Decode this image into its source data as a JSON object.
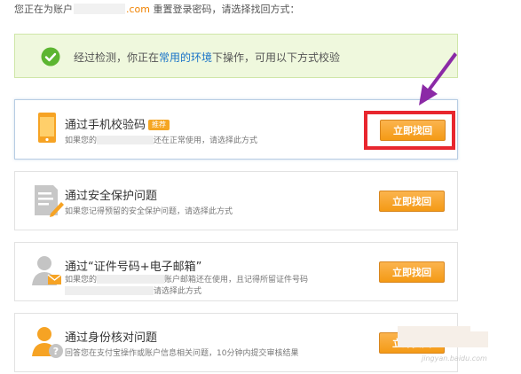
{
  "intro": {
    "prefix": "您正在为账户",
    "domain_suffix": ".com",
    "suffix": "重置登录密码，请选择找回方式："
  },
  "notice": {
    "text_before": "经过检测，你正在",
    "highlight": "常用的环境",
    "text_after": "下操作，可用以下方式校验",
    "icon": "check-circle-icon"
  },
  "methods": [
    {
      "title": "通过手机校验码",
      "badge": "推荐",
      "desc_before": "如果您的",
      "desc_after": "还在正常使用，请选择此方式",
      "button": "立即找回",
      "icon": "phone-icon"
    },
    {
      "title": "通过安全保护问题",
      "desc": "如果您记得预留的安全保护问题，请选择此方式",
      "button": "立即找回",
      "icon": "document-edit-icon"
    },
    {
      "title": "通过“证件号码+电子邮箱”",
      "desc_line1_before": "如果您的",
      "desc_line1_after": "账户邮箱还在使用，且记得所留证件号码",
      "desc_line2": "请选择此方式",
      "button": "立即找回",
      "icon": "user-mail-icon"
    },
    {
      "title": "通过身份核对问题",
      "desc": "回答您在支付宝操作或账户信息相关问题，10分钟内提交审核结果",
      "button": "立即找回",
      "icon": "user-question-icon"
    }
  ],
  "watermark": "jingyan.baidu.com",
  "colors": {
    "accent": "#f49a15",
    "highlight_box": "#e8262e",
    "arrow": "#8b2aa6",
    "notice_bg": "#eff8dd",
    "link": "#1a73c8"
  }
}
